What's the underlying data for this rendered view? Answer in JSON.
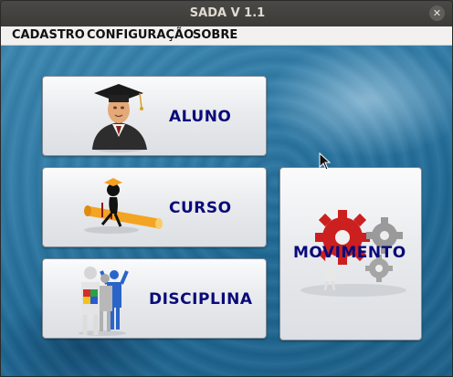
{
  "window": {
    "title": "SADA V 1.1",
    "close_icon": "close-icon"
  },
  "menubar": {
    "items": [
      "CADASTRO",
      "CONFIGURAÇÃO",
      "SOBRE"
    ]
  },
  "buttons": {
    "aluno": {
      "label": "ALUNO",
      "icon": "graduate-icon"
    },
    "curso": {
      "label": "CURSO",
      "icon": "diploma-icon"
    },
    "disciplina": {
      "label": "DISCIPLINA",
      "icon": "puzzle-people-icon"
    },
    "movimento": {
      "label": "MOVIMENTO",
      "icon": "gears-icon"
    }
  },
  "colors": {
    "label": "#0a0a7a",
    "accent_red": "#cc1f1f",
    "cap_orange": "#f0a020"
  }
}
